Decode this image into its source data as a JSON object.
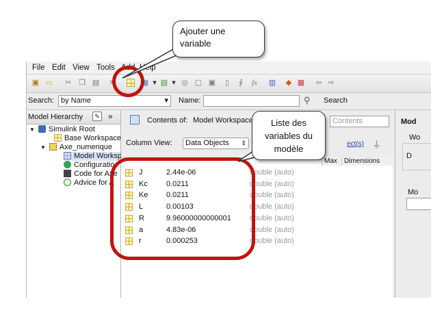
{
  "menu": [
    "File",
    "Edit",
    "View",
    "Tools",
    "Add",
    "Help"
  ],
  "search": {
    "label": "Search:",
    "by_value": "by Name",
    "name_label": "Name:",
    "name_value": "",
    "button": "Search"
  },
  "hierarchy": {
    "title": "Model Hierarchy",
    "items": [
      "Simulink Root",
      "Base Workspace",
      "Axe_numerique",
      "Model Workspace",
      "Configuratio",
      "Code for Axe",
      "Advice for A"
    ]
  },
  "contents": {
    "title": "Contents of:",
    "title_value": "Model Workspace",
    "search_placeholder": "Contents",
    "column_view_label": "Column View:",
    "column_view_value": "Data Objects",
    "show_link": "ect(s)",
    "headers": {
      "max": "Max",
      "dimensions": "Dimensions"
    },
    "rows": [
      {
        "name": "J",
        "value": "2.44e-06",
        "type": "double (auto)"
      },
      {
        "name": "Kc",
        "value": "0.0211",
        "type": "double (auto)"
      },
      {
        "name": "Ke",
        "value": "0.0211",
        "type": "double (auto)"
      },
      {
        "name": "L",
        "value": "0.00103",
        "type": "double (auto)"
      },
      {
        "name": "R",
        "value": "9.96000000000001",
        "type": "double (auto)"
      },
      {
        "name": "a",
        "value": "4.83e-06",
        "type": "double (auto)"
      },
      {
        "name": "r",
        "value": "0.000253",
        "type": "double (auto)"
      }
    ]
  },
  "right_panel": {
    "title": "Mod",
    "label1": "Wo",
    "label2": "D",
    "label3": "Mo"
  },
  "callouts": {
    "add_variable": "Ajouter une variable",
    "variables_list": "Liste des variables du modèle"
  },
  "colors": {
    "highlight_ring": "#c0140e",
    "selected_row": "#d8e4f6"
  }
}
